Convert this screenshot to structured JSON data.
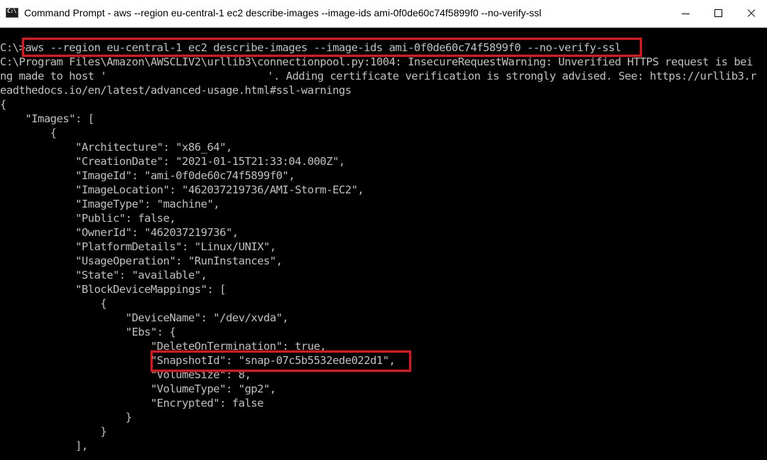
{
  "window": {
    "title": "Command Prompt - aws  --region eu-central-1 ec2 describe-images --image-ids ami-0f0de60c74f5899f0 --no-verify-ssl",
    "icon": "cmd-icon",
    "controls": [
      "minimize-icon",
      "maximize-icon",
      "close-icon"
    ]
  },
  "console": {
    "prompt": "C:\\>",
    "command": "aws --region eu-central-1 ec2 describe-images --image-ids ami-0f0de60c74f5899f0 --no-verify-ssl",
    "warning_line1": "C:\\Program Files\\Amazon\\AWSCLIV2\\urllib3\\connectionpool.py:1004: InsecureRequestWarning: Unverified HTTPS request is bei",
    "warning_line2_a": "ng made to host '",
    "warning_line2_b": "'. Adding certificate verification is strongly advised. See: https://urllib3.r",
    "warning_line3": "eadthedocs.io/en/latest/advanced-usage.html#ssl-warnings",
    "json_lines": [
      "{",
      "    \"Images\": [",
      "        {",
      "            \"Architecture\": \"x86_64\",",
      "            \"CreationDate\": \"2021-01-15T21:33:04.000Z\",",
      "            \"ImageId\": \"ami-0f0de60c74f5899f0\",",
      "            \"ImageLocation\": \"462037219736/AMI-Storm-EC2\",",
      "            \"ImageType\": \"machine\",",
      "            \"Public\": false,",
      "            \"OwnerId\": \"462037219736\",",
      "            \"PlatformDetails\": \"Linux/UNIX\",",
      "            \"UsageOperation\": \"RunInstances\",",
      "            \"State\": \"available\",",
      "            \"BlockDeviceMappings\": [",
      "                {",
      "                    \"DeviceName\": \"/dev/xvda\",",
      "                    \"Ebs\": {",
      "                        \"DeleteOnTermination\": true,",
      "                        \"SnapshotId\": \"snap-07c5b5532ede022d1\",",
      "                        \"VolumeSize\": 8,",
      "                        \"VolumeType\": \"gp2\",",
      "                        \"Encrypted\": false",
      "                    }",
      "                }",
      "            ],"
    ]
  },
  "colors": {
    "console_bg": "#000000",
    "console_text": "#c0c0c0",
    "highlight": "#e8121d",
    "titlebar_bg": "#ffffff"
  }
}
